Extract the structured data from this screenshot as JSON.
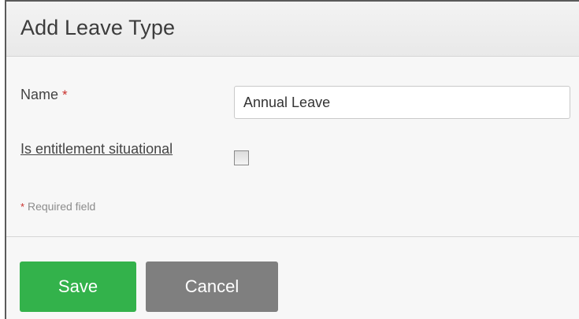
{
  "panel": {
    "title": "Add Leave Type"
  },
  "form": {
    "name": {
      "label": "Name",
      "required_mark": "*",
      "value": "Annual Leave"
    },
    "entitlement": {
      "label": "Is entitlement situational",
      "checked": false
    },
    "required_note": {
      "mark": "*",
      "text": " Required field"
    }
  },
  "actions": {
    "save_label": "Save",
    "cancel_label": "Cancel"
  },
  "colors": {
    "save": "#33b24b",
    "cancel": "#7f7f7f",
    "required": "#c9302c"
  }
}
